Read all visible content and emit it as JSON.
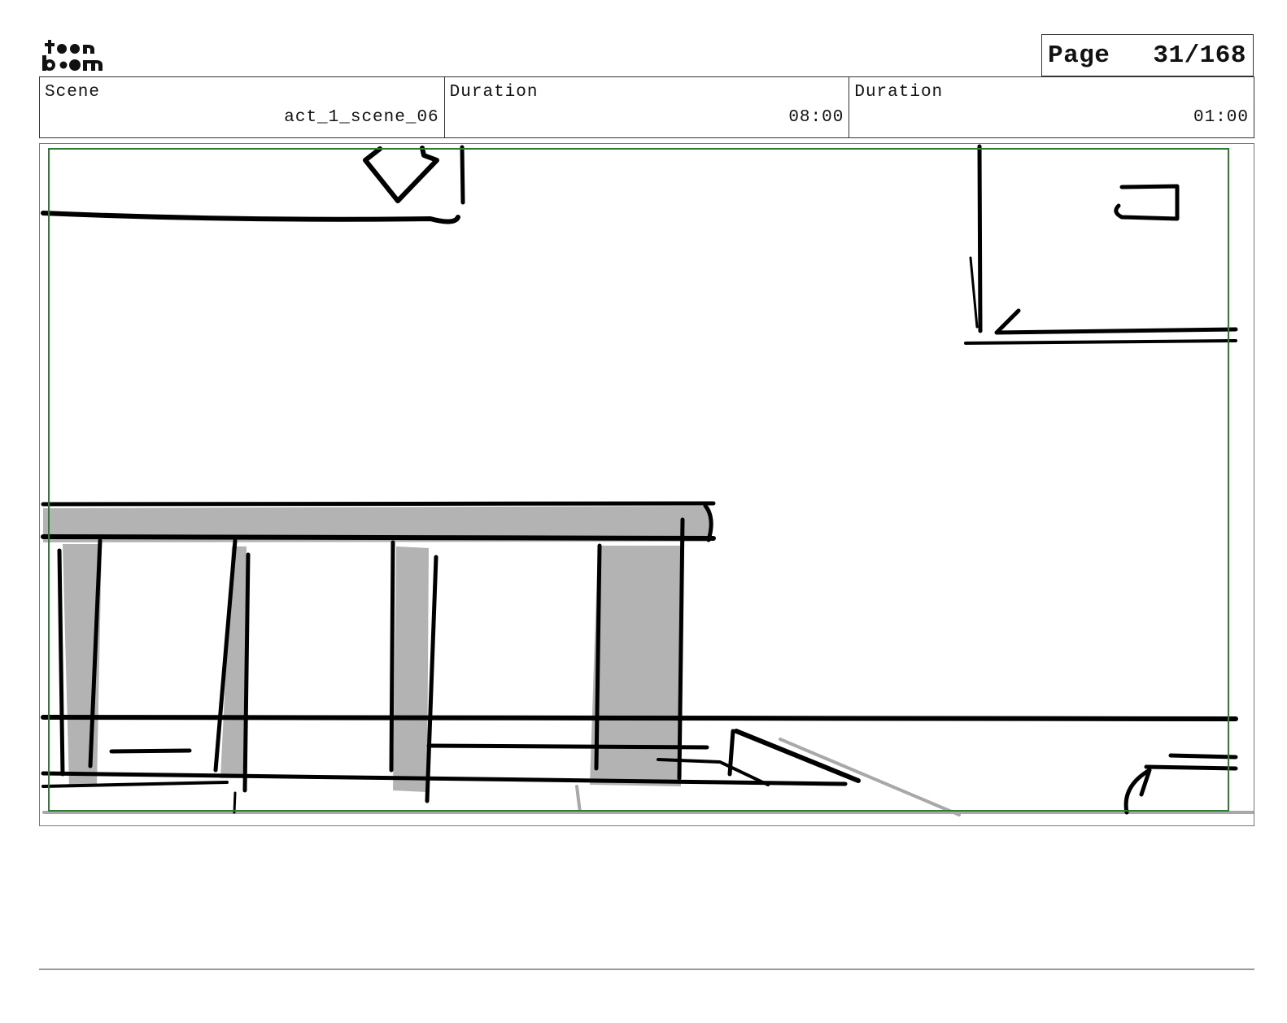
{
  "header": {
    "logo_text": "toon boom",
    "page_label": "Page",
    "page_number": "31/168"
  },
  "info": [
    {
      "label": "Scene",
      "value": "act_1_scene_06"
    },
    {
      "label": "Duration",
      "value": "08:00"
    },
    {
      "label": "Duration",
      "value": "01:00"
    }
  ],
  "panel": {
    "safe_frame_color": "#2e7d32",
    "ink_color": "#000000",
    "tone_color": "#b3b3b3"
  }
}
